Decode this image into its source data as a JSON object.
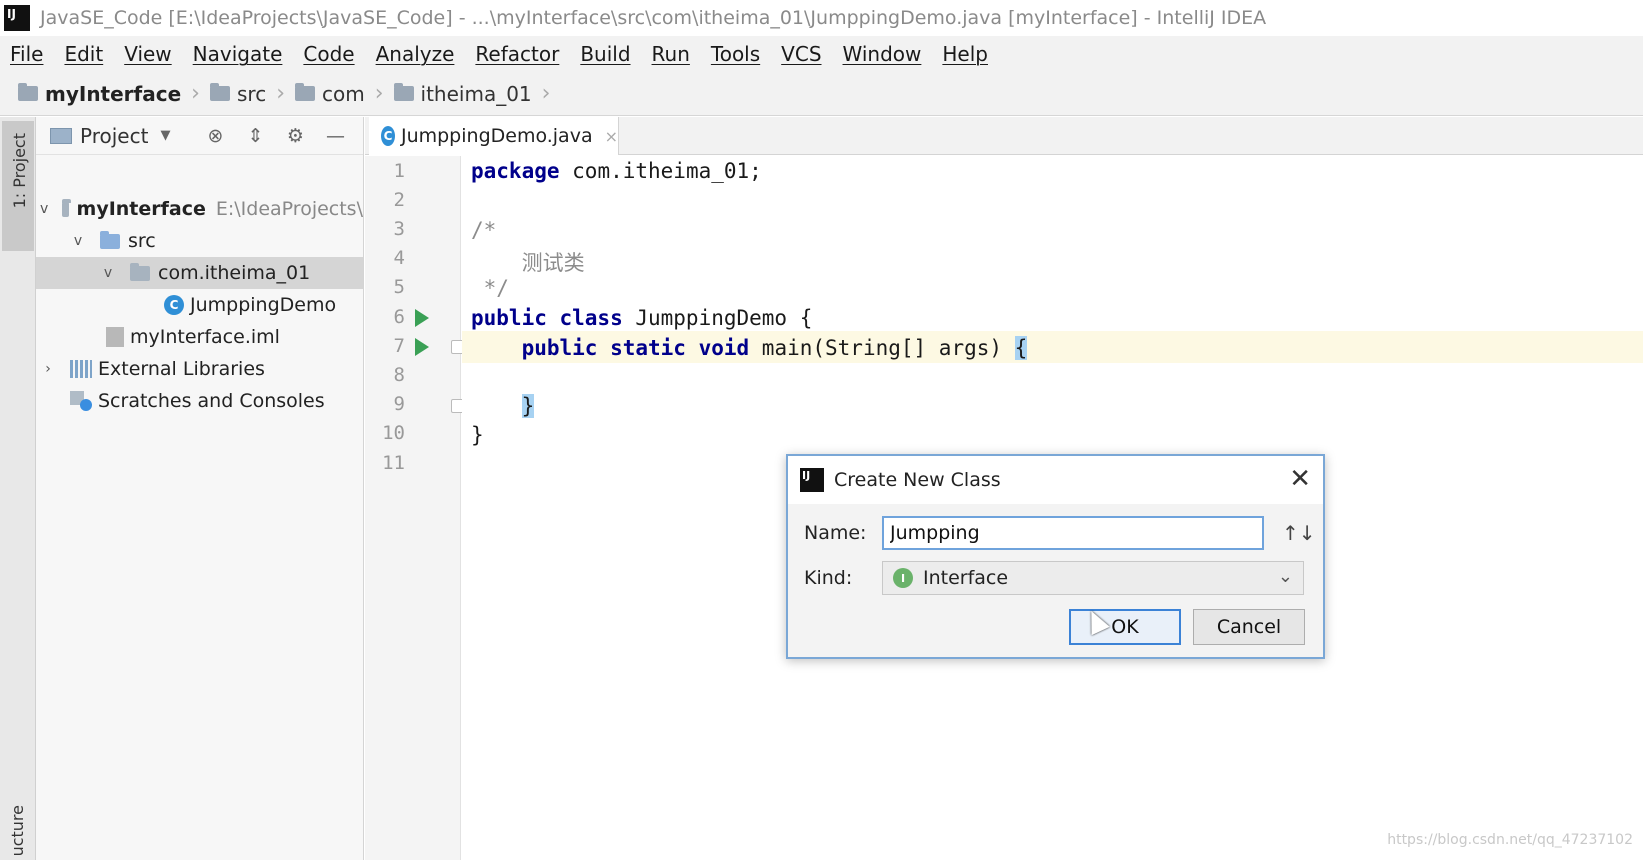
{
  "window": {
    "title": "JavaSE_Code [E:\\IdeaProjects\\JavaSE_Code] - ...\\myInterface\\src\\com\\itheima_01\\JumppingDemo.java [myInterface] - IntelliJ IDEA",
    "logo_text": "IJ"
  },
  "menu": [
    "File",
    "Edit",
    "View",
    "Navigate",
    "Code",
    "Analyze",
    "Refactor",
    "Build",
    "Run",
    "Tools",
    "VCS",
    "Window",
    "Help"
  ],
  "breadcrumb": [
    "myInterface",
    "src",
    "com",
    "itheima_01"
  ],
  "side_strip": {
    "project_tab": "1: Project",
    "structure_tab": "ucture"
  },
  "project_panel": {
    "title": "Project",
    "tree": [
      {
        "label": "myInterface",
        "hint": "E:\\IdeaProjects\\"
      },
      {
        "label": "src"
      },
      {
        "label": "com.itheima_01"
      },
      {
        "label": "JumppingDemo"
      },
      {
        "label": "myInterface.iml"
      },
      {
        "label": "External Libraries"
      },
      {
        "label": "Scratches and Consoles"
      }
    ]
  },
  "editor": {
    "tab_label": "JumppingDemo.java",
    "line_numbers": [
      "1",
      "2",
      "3",
      "4",
      "5",
      "6",
      "7",
      "8",
      "9",
      "10",
      "11"
    ],
    "code": {
      "l1_kw": "package",
      "l1_rest": " com.itheima_01;",
      "l3": "/*",
      "l4": "    测试类",
      "l5": " */",
      "l6_kw": "public class",
      "l6_rest": " JumppingDemo {",
      "l7_indent": "    ",
      "l7_kw": "public static void",
      "l7_rest": " main(String[] args) ",
      "l7_brace": "{",
      "l9_indent": "    ",
      "l9_brace": "}",
      "l10": "}"
    }
  },
  "dialog": {
    "title": "Create New Class",
    "name_label": "Name:",
    "name_value": "Jumpping",
    "kind_label": "Kind:",
    "kind_value": "Interface",
    "ok_label": "OK",
    "cancel_label": "Cancel"
  },
  "watermark": "https://blog.csdn.net/qq_47237102"
}
